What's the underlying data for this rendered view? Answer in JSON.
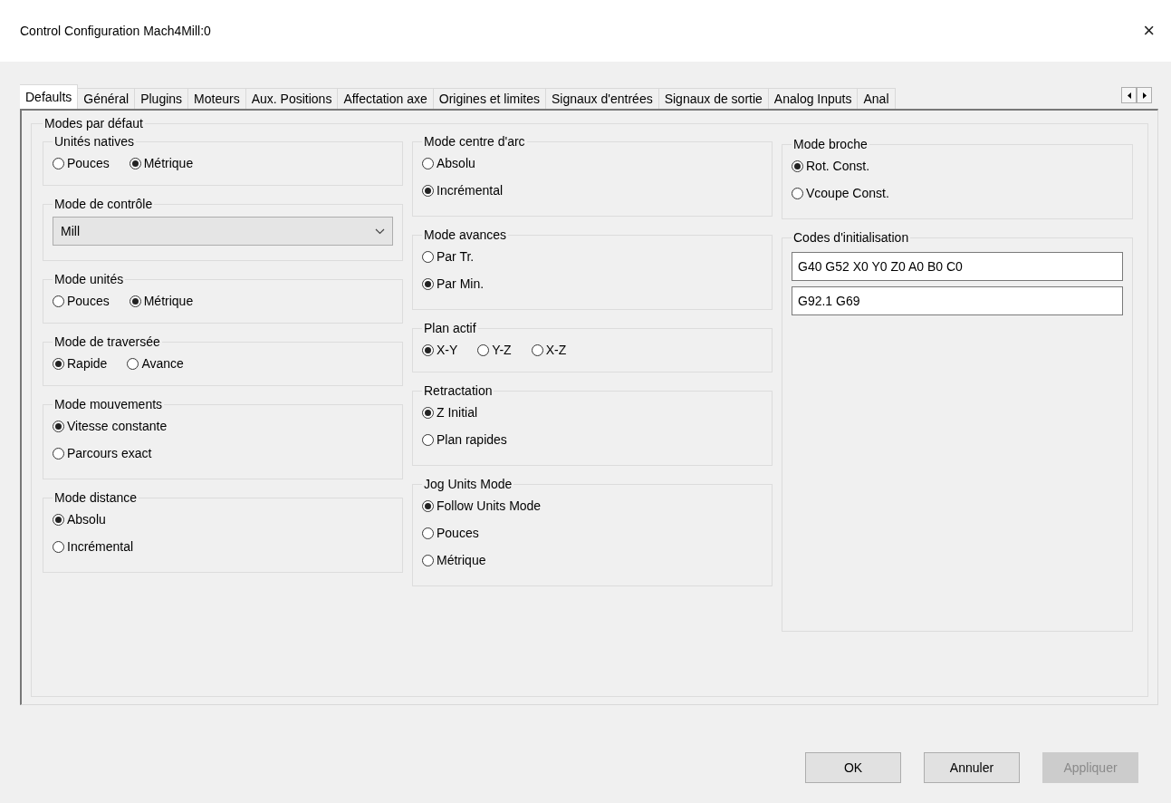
{
  "window": {
    "title": "Control Configuration Mach4Mill:0",
    "close": "×"
  },
  "tabs": [
    {
      "label": "Defaults",
      "selected": true
    },
    {
      "label": "Général",
      "selected": false
    },
    {
      "label": "Plugins",
      "selected": false
    },
    {
      "label": "Moteurs",
      "selected": false
    },
    {
      "label": "Aux. Positions",
      "selected": false
    },
    {
      "label": "Affectation axe",
      "selected": false
    },
    {
      "label": "Origines et limites",
      "selected": false
    },
    {
      "label": "Signaux d'entrées",
      "selected": false
    },
    {
      "label": "Signaux de sortie",
      "selected": false
    },
    {
      "label": "Analog Inputs",
      "selected": false
    },
    {
      "label": "Anal",
      "selected": false
    }
  ],
  "panel": {
    "title": "Modes par défaut",
    "columns": [
      [
        {
          "title": "Unités natives",
          "kind": "radio-row",
          "options": [
            {
              "label": "Pouces",
              "selected": false
            },
            {
              "label": "Métrique",
              "selected": true
            }
          ]
        },
        {
          "title": "Mode de contrôle",
          "kind": "select",
          "value": "Mill"
        },
        {
          "title": "Mode unités",
          "kind": "radio-row",
          "options": [
            {
              "label": "Pouces",
              "selected": false
            },
            {
              "label": "Métrique",
              "selected": true
            }
          ]
        },
        {
          "title": "Mode de traversée",
          "kind": "radio-row",
          "options": [
            {
              "label": "Rapide",
              "selected": true
            },
            {
              "label": "Avance",
              "selected": false
            }
          ]
        },
        {
          "title": "Mode mouvements",
          "kind": "radio-column",
          "options": [
            {
              "label": "Vitesse constante",
              "selected": true
            },
            {
              "label": "Parcours exact",
              "selected": false
            }
          ]
        },
        {
          "title": "Mode distance",
          "kind": "radio-column",
          "options": [
            {
              "label": "Absolu",
              "selected": true
            },
            {
              "label": "Incrémental",
              "selected": false
            }
          ]
        }
      ],
      [
        {
          "title": "Mode centre d'arc",
          "kind": "radio-column",
          "options": [
            {
              "label": "Absolu",
              "selected": false
            },
            {
              "label": "Incrémental",
              "selected": true
            }
          ]
        },
        {
          "title": "Mode avances",
          "kind": "radio-column",
          "options": [
            {
              "label": "Par Tr.",
              "selected": false
            },
            {
              "label": "Par Min.",
              "selected": true
            }
          ]
        },
        {
          "title": "Plan actif",
          "kind": "radio-row",
          "options": [
            {
              "label": "X-Y",
              "selected": true
            },
            {
              "label": "Y-Z",
              "selected": false
            },
            {
              "label": "X-Z",
              "selected": false
            }
          ]
        },
        {
          "title": "Retractation",
          "kind": "radio-column",
          "options": [
            {
              "label": "Z Initial",
              "selected": true
            },
            {
              "label": "Plan rapides",
              "selected": false
            }
          ]
        },
        {
          "title": "Jog Units Mode",
          "kind": "radio-column",
          "options": [
            {
              "label": "Follow Units Mode",
              "selected": true
            },
            {
              "label": "Pouces",
              "selected": false
            },
            {
              "label": "Métrique",
              "selected": false
            }
          ]
        }
      ],
      [
        {
          "title": "Mode broche",
          "kind": "radio-column",
          "options": [
            {
              "label": "Rot. Const.",
              "selected": true
            },
            {
              "label": "Vcoupe Const.",
              "selected": false
            }
          ]
        },
        {
          "title": "Codes d'initialisation",
          "kind": "fields",
          "fields": [
            "G40 G52 X0 Y0 Z0 A0 B0 C0",
            "G92.1 G69"
          ]
        }
      ]
    ]
  },
  "buttons": [
    {
      "label": "OK",
      "disabled": false
    },
    {
      "label": "Annuler",
      "disabled": false
    },
    {
      "label": "Appliquer",
      "disabled": true
    }
  ]
}
